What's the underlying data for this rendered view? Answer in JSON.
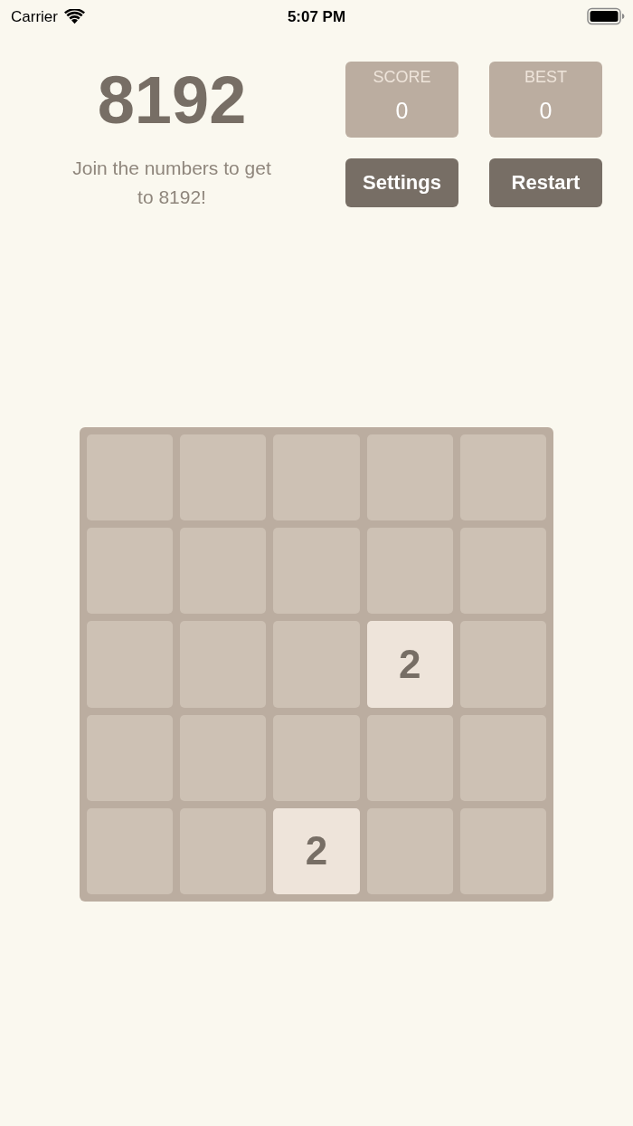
{
  "status_bar": {
    "carrier": "Carrier",
    "time": "5:07 PM"
  },
  "header": {
    "title": "8192",
    "subtitle": "Join the numbers to get to 8192!"
  },
  "scores": [
    {
      "label": "SCORE",
      "value": "0"
    },
    {
      "label": "BEST",
      "value": "0"
    }
  ],
  "buttons": [
    "Settings",
    "Restart"
  ],
  "board": {
    "rows": [
      [
        {
          "kind": "empty"
        },
        {
          "kind": "empty"
        },
        {
          "kind": "empty"
        },
        {
          "kind": "empty"
        },
        {
          "kind": "empty"
        }
      ],
      [
        {
          "kind": "empty"
        },
        {
          "kind": "empty"
        },
        {
          "kind": "empty"
        },
        {
          "kind": "empty"
        },
        {
          "kind": "empty"
        }
      ],
      [
        {
          "kind": "empty"
        },
        {
          "kind": "empty"
        },
        {
          "kind": "empty"
        },
        {
          "kind": "tile",
          "value": "2"
        },
        {
          "kind": "empty"
        }
      ],
      [
        {
          "kind": "empty"
        },
        {
          "kind": "empty"
        },
        {
          "kind": "empty"
        },
        {
          "kind": "empty"
        },
        {
          "kind": "empty"
        }
      ],
      [
        {
          "kind": "empty"
        },
        {
          "kind": "empty"
        },
        {
          "kind": "tile",
          "value": "2"
        },
        {
          "kind": "empty"
        },
        {
          "kind": "empty"
        }
      ]
    ]
  }
}
